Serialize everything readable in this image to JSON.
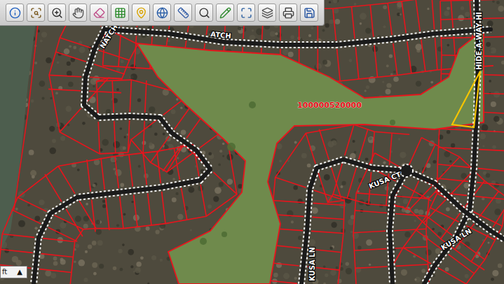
{
  "toolbar": {
    "tools": [
      {
        "kind": "info",
        "selected": false
      },
      {
        "kind": "identify",
        "selected": false
      },
      {
        "kind": "zoom-in",
        "selected": false
      },
      {
        "kind": "pan",
        "selected": false
      },
      {
        "kind": "erase",
        "selected": false
      },
      {
        "kind": "select-box",
        "selected": false
      },
      {
        "kind": "pin",
        "selected": false
      },
      {
        "kind": "globe",
        "selected": false
      },
      {
        "kind": "measure",
        "selected": false
      },
      {
        "kind": "search",
        "selected": false
      },
      {
        "kind": "draw",
        "selected": false
      },
      {
        "kind": "full-extent",
        "selected": false
      },
      {
        "kind": "layers",
        "selected": false
      },
      {
        "kind": "print",
        "selected": false
      },
      {
        "kind": "save",
        "selected": false
      }
    ]
  },
  "map": {
    "labels": [
      {
        "text": "NATCHE",
        "kind": "road"
      },
      {
        "text": "ATCH",
        "kind": "road"
      },
      {
        "text": "HIDE-A-WAY HI",
        "kind": "road"
      },
      {
        "text": "100000520000",
        "kind": "parcel"
      },
      {
        "text": "KUSA CT",
        "kind": "road"
      },
      {
        "text": "KUSA LN",
        "kind": "road"
      },
      {
        "text": "KUSA LN",
        "kind": "road"
      }
    ],
    "selected_parcel": {
      "selected": true
    }
  },
  "scale": {
    "unit": "ft",
    "toggle": "▲"
  }
}
